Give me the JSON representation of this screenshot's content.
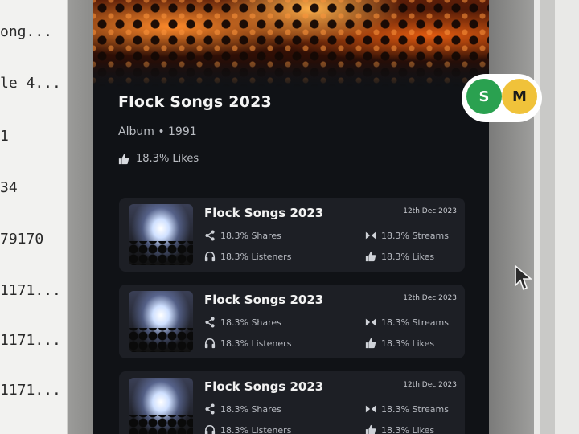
{
  "left_list": {
    "rows": [
      "ong...",
      "le 4...",
      "1",
      "34",
      "79170",
      "1171...",
      "1171...",
      "1171..."
    ]
  },
  "album": {
    "title": "Flock Songs 2023",
    "meta": "Album • 1991",
    "likes": "18.3% Likes"
  },
  "avatars": [
    "S",
    "M"
  ],
  "songs": [
    {
      "title": "Flock Songs 2023",
      "date": "12th Dec 2023",
      "shares": "18.3% Shares",
      "listeners": "18.3% Listeners",
      "streams": "18.3% Streams",
      "likes": "18.3% Likes"
    },
    {
      "title": "Flock Songs 2023",
      "date": "12th Dec 2023",
      "shares": "18.3% Shares",
      "listeners": "18.3% Listeners",
      "streams": "18.3% Streams",
      "likes": "18.3% Likes"
    },
    {
      "title": "Flock Songs 2023",
      "date": "12th Dec 2023",
      "shares": "18.3% Shares",
      "listeners": "18.3% Listeners",
      "streams": "18.3% Streams",
      "likes": "18.3% Likes"
    }
  ],
  "colors": {
    "panel_bg": "#101216",
    "card_bg": "#1d1f25",
    "avatar_s": "#2aa150",
    "avatar_m": "#f0c23a"
  },
  "icons": {
    "share": "share-icon",
    "headphones": "headphones-icon",
    "streams": "streams-icon",
    "like": "thumbs-up-icon",
    "cursor": "mouse-cursor-icon"
  }
}
